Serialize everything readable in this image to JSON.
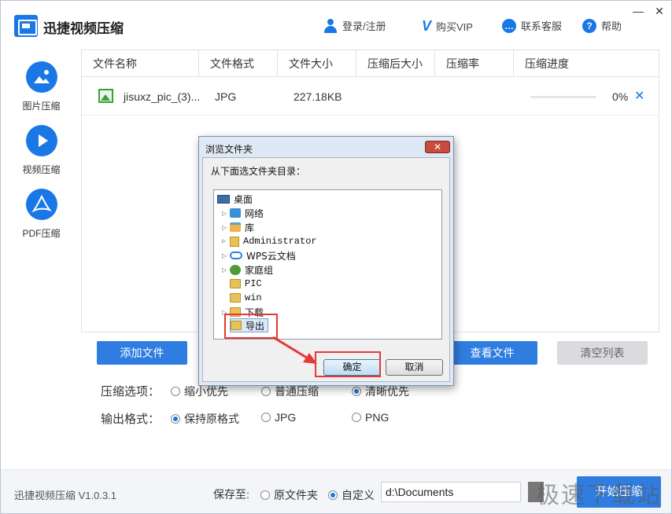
{
  "app": {
    "title": "迅捷视频压缩",
    "header": {
      "login": "登录/注册",
      "buy_vip": "购买VIP",
      "support": "联系客服",
      "help": "帮助"
    },
    "window_controls": {
      "minimize": "—",
      "close": "✕"
    }
  },
  "sidebar": {
    "items": [
      {
        "label": "图片压缩",
        "icon": "image-icon"
      },
      {
        "label": "视频压缩",
        "icon": "play-icon"
      },
      {
        "label": "PDF压缩",
        "icon": "pdf-icon"
      }
    ]
  },
  "table": {
    "columns": [
      "文件名称",
      "文件格式",
      "文件大小",
      "压缩后大小",
      "压缩率",
      "压缩进度"
    ],
    "rows": [
      {
        "name": "jisuxz_pic_(3)...",
        "format": "JPG",
        "size": "227.18KB",
        "compressed_size": "",
        "ratio": "",
        "progress_text": "0%",
        "progress": 0
      }
    ]
  },
  "buttons": {
    "add_file": "添加文件",
    "view_file": "查看文件",
    "clear_list": "清空列表"
  },
  "options": {
    "compress_label": "压缩选项：",
    "compress_options": [
      "缩小优先",
      "普通压缩",
      "清晰优先"
    ],
    "compress_selected": 2,
    "output_label": "输出格式：",
    "output_options": [
      "保持原格式",
      "JPG",
      "PNG"
    ],
    "output_selected": 0
  },
  "footer": {
    "version": "迅捷视频压缩 V1.0.3.1",
    "save_to": "保存至:",
    "save_options": [
      "原文件夹",
      "自定义"
    ],
    "save_selected": 1,
    "path": "d:\\Documents",
    "start": "开始压缩",
    "watermark": "极速下载站"
  },
  "dialog": {
    "title": "浏览文件夹",
    "instruction": "从下面选文件夹目录：",
    "tree": [
      {
        "label": "桌面",
        "expander": "",
        "icon": "desktop-icon"
      },
      {
        "label": "网络",
        "expander": "▷",
        "icon": "network-icon"
      },
      {
        "label": "库",
        "expander": "▷",
        "icon": "library-icon"
      },
      {
        "label": "Administrator",
        "expander": "▷",
        "icon": "user-folder-icon"
      },
      {
        "label": "WPS云文档",
        "expander": "▷",
        "icon": "cloud-icon"
      },
      {
        "label": "家庭组",
        "expander": "▷",
        "icon": "homegroup-icon"
      },
      {
        "label": "PIC",
        "expander": "",
        "icon": "folder-icon"
      },
      {
        "label": "win",
        "expander": "",
        "icon": "folder-icon"
      },
      {
        "label": "下载",
        "expander": "▷",
        "icon": "folder-icon"
      },
      {
        "label": "导出",
        "expander": "",
        "icon": "folder-icon",
        "selected": true
      }
    ],
    "ok": "确定",
    "cancel": "取消",
    "close": "✕"
  },
  "colors": {
    "accent": "#2f7de1",
    "annotation": "#e53935"
  }
}
